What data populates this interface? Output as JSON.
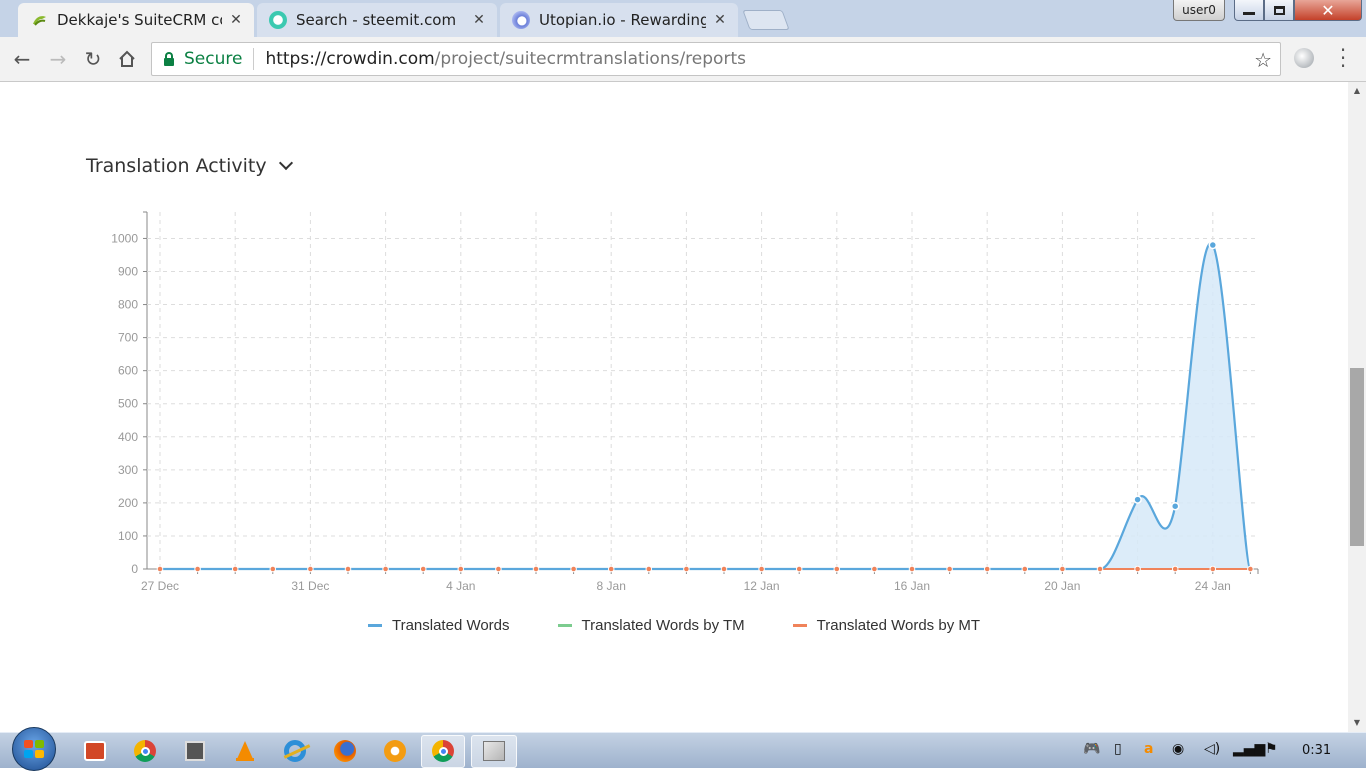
{
  "browser": {
    "tabs": [
      {
        "title": "Dekkaje's SuiteCRM core",
        "favicon": "crowdin-icon",
        "active": true
      },
      {
        "title": "Search - steemit.com",
        "favicon": "steemit-icon",
        "active": false
      },
      {
        "title": "Utopian.io - Rewarding O",
        "favicon": "utopian-icon",
        "active": false
      }
    ],
    "user_badge": "user0",
    "secure_label": "Secure",
    "url_host": "https://crowdin.com",
    "url_path": "/project/suitecrmtranslations/reports"
  },
  "page": {
    "section_title": "Translation Activity"
  },
  "chart_data": {
    "type": "area",
    "title": "Translation Activity",
    "x": [
      "27 Dec",
      "28 Dec",
      "29 Dec",
      "30 Dec",
      "31 Dec",
      "1 Jan",
      "2 Jan",
      "3 Jan",
      "4 Jan",
      "5 Jan",
      "6 Jan",
      "7 Jan",
      "8 Jan",
      "9 Jan",
      "10 Jan",
      "11 Jan",
      "12 Jan",
      "13 Jan",
      "14 Jan",
      "15 Jan",
      "16 Jan",
      "17 Jan",
      "18 Jan",
      "19 Jan",
      "20 Jan",
      "21 Jan",
      "22 Jan",
      "23 Jan",
      "24 Jan",
      "25 Jan"
    ],
    "x_tick_labels": [
      "27 Dec",
      "31 Dec",
      "4 Jan",
      "8 Jan",
      "12 Jan",
      "16 Jan",
      "20 Jan",
      "24 Jan"
    ],
    "y_ticks": [
      0,
      100,
      200,
      300,
      400,
      500,
      600,
      700,
      800,
      900,
      1000
    ],
    "ylim": [
      0,
      1080
    ],
    "grid": true,
    "legend_position": "bottom",
    "series": [
      {
        "name": "Translated Words",
        "color": "#5aa7dc",
        "values": [
          0,
          0,
          0,
          0,
          0,
          0,
          0,
          0,
          0,
          0,
          0,
          0,
          0,
          0,
          0,
          0,
          0,
          0,
          0,
          0,
          0,
          0,
          0,
          0,
          0,
          0,
          210,
          190,
          980,
          0
        ]
      },
      {
        "name": "Translated Words by TM",
        "color": "#7ccc8f",
        "values": [
          0,
          0,
          0,
          0,
          0,
          0,
          0,
          0,
          0,
          0,
          0,
          0,
          0,
          0,
          0,
          0,
          0,
          0,
          0,
          0,
          0,
          0,
          0,
          0,
          0,
          0,
          0,
          0,
          0,
          0
        ]
      },
      {
        "name": "Translated Words by MT",
        "color": "#f0835a",
        "values": [
          0,
          0,
          0,
          0,
          0,
          0,
          0,
          0,
          0,
          0,
          0,
          0,
          0,
          0,
          0,
          0,
          0,
          0,
          0,
          0,
          0,
          0,
          0,
          0,
          0,
          0,
          0,
          0,
          0,
          0
        ]
      }
    ]
  },
  "taskbar": {
    "apps": [
      "powerpoint-icon",
      "chrome-icon",
      "media-icon",
      "vlc-icon",
      "ie-icon",
      "firefox-icon",
      "settings-icon",
      "chrome-active-icon",
      "paint-icon"
    ],
    "clock": "0:31"
  }
}
